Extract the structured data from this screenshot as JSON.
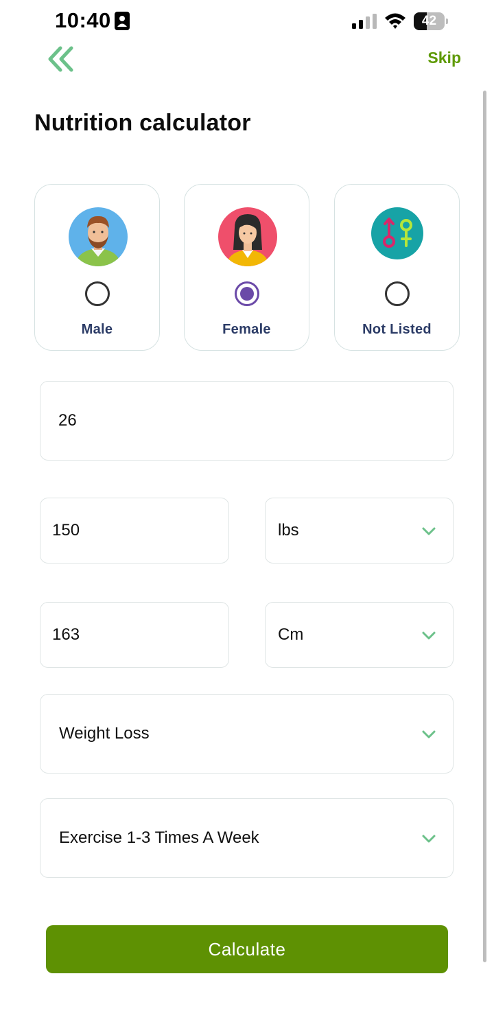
{
  "status_bar": {
    "time": "10:40",
    "battery_level": "42",
    "battery_fraction": 0.42
  },
  "header": {
    "back_icon": "double-chevron-left-icon",
    "skip_label": "Skip"
  },
  "title": "Nutrition calculator",
  "genders": [
    {
      "label": "Male",
      "icon": "male-avatar-icon",
      "selected": false
    },
    {
      "label": "Female",
      "icon": "female-avatar-icon",
      "selected": true
    },
    {
      "label": "Not Listed",
      "icon": "gender-symbols-icon",
      "selected": false
    }
  ],
  "form": {
    "age": "26",
    "weight": "150",
    "weight_unit": "lbs",
    "height": "163",
    "height_unit": "Cm",
    "goal": "Weight Loss",
    "activity": "Exercise 1-3 Times A Week"
  },
  "calculate_label": "Calculate",
  "colors": {
    "accent_green": "#5e9a04",
    "button_green": "#5e9103",
    "back_icon_green": "#6cc18a",
    "radio_purple": "#6b4aa8",
    "label_navy": "#2b3b66"
  }
}
